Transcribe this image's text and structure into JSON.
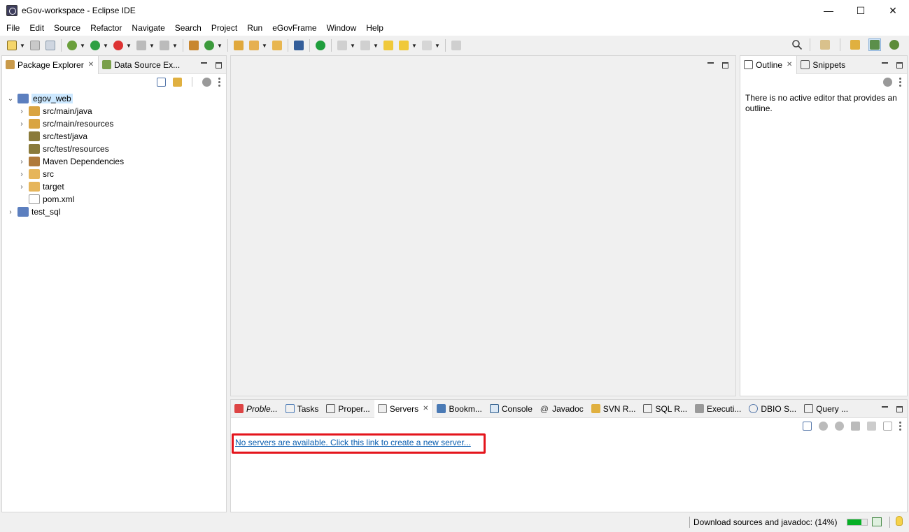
{
  "window": {
    "title": "eGov-workspace - Eclipse IDE",
    "controls": [
      "—",
      "☐",
      "✕"
    ]
  },
  "menu": [
    "File",
    "Edit",
    "Source",
    "Refactor",
    "Navigate",
    "Search",
    "Project",
    "Run",
    "eGovFrame",
    "Window",
    "Help"
  ],
  "left_panel": {
    "tabs": [
      {
        "label": "Package Explorer",
        "active": true,
        "closable": true
      },
      {
        "label": "Data Source Ex...",
        "active": false,
        "closable": false
      }
    ],
    "tree": [
      {
        "label": "egov_web",
        "level": 0,
        "expanded": true,
        "twisty": "v",
        "selected": true,
        "icon": "maven-project-icon"
      },
      {
        "label": "src/main/java",
        "level": 1,
        "twisty": ">",
        "icon": "source-folder-icon"
      },
      {
        "label": "src/main/resources",
        "level": 1,
        "twisty": ">",
        "icon": "source-folder-icon"
      },
      {
        "label": "src/test/java",
        "level": 1,
        "twisty": "",
        "icon": "source-folder-icon"
      },
      {
        "label": "src/test/resources",
        "level": 1,
        "twisty": "",
        "icon": "source-folder-icon"
      },
      {
        "label": "Maven Dependencies",
        "level": 1,
        "twisty": ">",
        "icon": "library-icon"
      },
      {
        "label": "src",
        "level": 1,
        "twisty": ">",
        "icon": "folder-icon"
      },
      {
        "label": "target",
        "level": 1,
        "twisty": ">",
        "icon": "folder-icon"
      },
      {
        "label": "pom.xml",
        "level": 1,
        "twisty": "",
        "icon": "pom-file-icon"
      },
      {
        "label": "test_sql",
        "level": 0,
        "twisty": ">",
        "icon": "project-icon"
      }
    ]
  },
  "right_panel": {
    "tabs": [
      {
        "label": "Outline",
        "active": true,
        "closable": true
      },
      {
        "label": "Snippets",
        "active": false,
        "closable": false
      }
    ],
    "message": "There is no active editor that provides an outline."
  },
  "bottom_panel": {
    "tabs": [
      {
        "label": "Proble...",
        "italic": true
      },
      {
        "label": "Tasks"
      },
      {
        "label": "Proper..."
      },
      {
        "label": "Servers",
        "active": true,
        "closable": true
      },
      {
        "label": "Bookm..."
      },
      {
        "label": "Console"
      },
      {
        "label": "Javadoc"
      },
      {
        "label": "SVN R..."
      },
      {
        "label": "SQL R..."
      },
      {
        "label": "Executi..."
      },
      {
        "label": "DBIO S..."
      },
      {
        "label": "Query ..."
      }
    ],
    "servers_link": "No servers are available. Click this link to create a new server..."
  },
  "status": {
    "text": "Download sources and javadoc: (14%)",
    "progress_percent": 14
  },
  "colors": {
    "accent_link": "#0b5fb1",
    "highlight": "#e4151c",
    "selection": "#cce8ff",
    "progress": "#06b025"
  }
}
